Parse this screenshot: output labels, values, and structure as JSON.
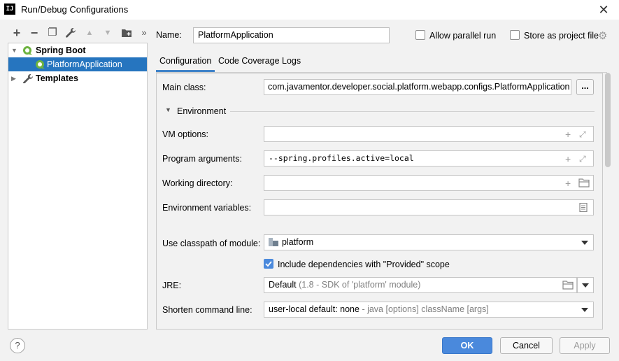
{
  "window": {
    "title": "Run/Debug Configurations",
    "close_glyph": "✕",
    "app_icon_text": "IJ"
  },
  "toolbar": {
    "icons": [
      "add-icon",
      "remove-icon",
      "copy-icon",
      "wrench-icon",
      "move-up-icon",
      "move-down-icon",
      "folder-icon",
      "more-icon"
    ],
    "glyphs": {
      "add": "+",
      "remove": "−",
      "copy": "❐",
      "wrench": "🔧",
      "up": "▲",
      "down": "▼",
      "folder": "▆",
      "more": "»"
    }
  },
  "tree": {
    "items": [
      {
        "label": "Spring Boot",
        "expanded": true,
        "bold": true
      },
      {
        "label": "PlatformApplication",
        "selected": true
      },
      {
        "label": "Templates",
        "expanded": false,
        "bold": true
      }
    ]
  },
  "header": {
    "name_label": "Name:",
    "name_value": "PlatformApplication",
    "allow_parallel_label": "Allow parallel run",
    "store_as_project_label": "Store as project file"
  },
  "tabs": [
    {
      "label": "Configuration",
      "active": true
    },
    {
      "label": "Code Coverage",
      "active": false
    },
    {
      "label": "Logs",
      "active": false
    }
  ],
  "config": {
    "main_class_label": "Main class:",
    "main_class_value": "com.javamentor.developer.social.platform.webapp.configs.PlatformApplication",
    "browse_label": "...",
    "environment_label": "Environment",
    "vm_options_label": "VM options:",
    "vm_options_value": "",
    "program_args_label": "Program arguments:",
    "program_args_value": "--spring.profiles.active=local",
    "working_dir_label": "Working directory:",
    "working_dir_value": "",
    "env_vars_label": "Environment variables:",
    "env_vars_value": "",
    "classpath_label": "Use classpath of module:",
    "classpath_value": "platform",
    "include_deps_label": "Include dependencies with \"Provided\" scope",
    "include_deps_checked": true,
    "jre_label": "JRE:",
    "jre_value": "Default",
    "jre_hint": "(1.8 - SDK of 'platform' module)",
    "shorten_label": "Shorten command line:",
    "shorten_value": "user-local default: none",
    "shorten_hint": "- java [options] className [args]"
  },
  "footer": {
    "help_label": "?",
    "ok_label": "OK",
    "cancel_label": "Cancel",
    "apply_label": "Apply"
  },
  "colors": {
    "accent": "#4a89dc",
    "selection": "#2675bf",
    "spring_green": "#6db33f"
  }
}
